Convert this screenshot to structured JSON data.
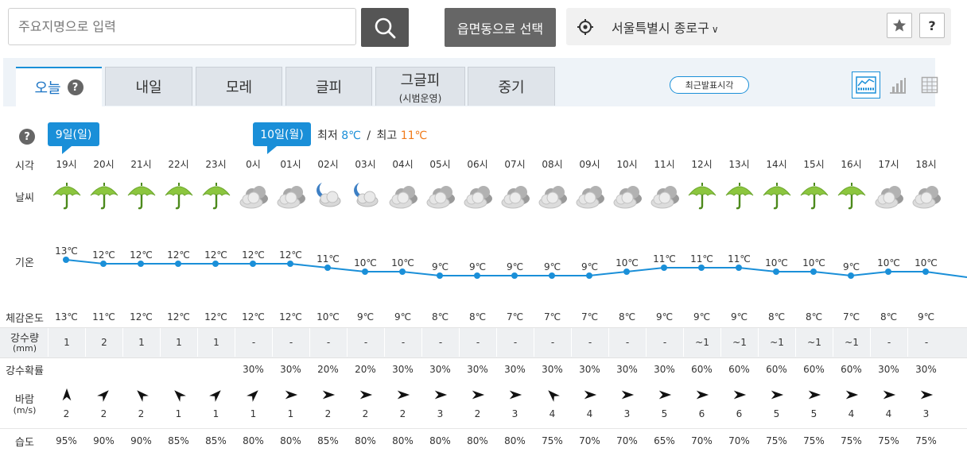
{
  "search": {
    "placeholder": "주요지명으로 입력"
  },
  "region_button": "읍면동으로 선택",
  "location": {
    "name": "서울특별시 종로구",
    "chevron": "∨"
  },
  "help_mark": "?",
  "tabs": [
    {
      "label": "오늘",
      "active": true,
      "has_help": true,
      "sub": ""
    },
    {
      "label": "내일",
      "active": false,
      "has_help": false,
      "sub": ""
    },
    {
      "label": "모레",
      "active": false,
      "has_help": false,
      "sub": ""
    },
    {
      "label": "글피",
      "active": false,
      "has_help": false,
      "sub": ""
    },
    {
      "label": "그글피",
      "active": false,
      "has_help": false,
      "sub": "(시범운영)"
    },
    {
      "label": "중기",
      "active": false,
      "has_help": false,
      "sub": ""
    }
  ],
  "recent_time_button": "최근발표시각",
  "view_toggles": [
    "graph-view-icon",
    "bar-chart-icon",
    "table-view-icon"
  ],
  "day_tags": [
    "9일(일)",
    "10일(월)"
  ],
  "minmax": {
    "min_label": "최저",
    "min_value": "8℃",
    "sep": "/",
    "max_label": "최고",
    "max_value": "11℃",
    "min_color": "#1a8fd8",
    "max_color": "#f07a1a"
  },
  "row_labels": {
    "time": "시각",
    "weather": "날씨",
    "temp": "기온",
    "feels": "체감온도",
    "precip": "강수량",
    "precip_unit": "(mm)",
    "prob": "강수확률",
    "wind": "바람",
    "wind_unit": "(m/s)",
    "humidity": "습도"
  },
  "hours": [
    {
      "time": "19시",
      "icon": "umbrella",
      "temp": "13℃",
      "t": 13,
      "feels": "13℃",
      "precip": "1",
      "prob": "",
      "dir": 0,
      "wind": "2",
      "hum": "95%"
    },
    {
      "time": "20시",
      "icon": "umbrella",
      "temp": "12℃",
      "t": 12,
      "feels": "11℃",
      "precip": "2",
      "prob": "",
      "dir": 45,
      "wind": "2",
      "hum": "90%"
    },
    {
      "time": "21시",
      "icon": "umbrella",
      "temp": "12℃",
      "t": 12,
      "feels": "12℃",
      "precip": "1",
      "prob": "",
      "dir": 315,
      "wind": "2",
      "hum": "90%"
    },
    {
      "time": "22시",
      "icon": "umbrella",
      "temp": "12℃",
      "t": 12,
      "feels": "12℃",
      "precip": "1",
      "prob": "",
      "dir": 315,
      "wind": "1",
      "hum": "85%"
    },
    {
      "time": "23시",
      "icon": "umbrella",
      "temp": "12℃",
      "t": 12,
      "feels": "12℃",
      "precip": "1",
      "prob": "",
      "dir": 45,
      "wind": "1",
      "hum": "85%"
    },
    {
      "time": "0시",
      "icon": "cloudy",
      "temp": "12℃",
      "t": 12,
      "feels": "12℃",
      "precip": "-",
      "prob": "30%",
      "dir": 45,
      "wind": "1",
      "hum": "80%"
    },
    {
      "time": "01시",
      "icon": "cloudy",
      "temp": "12℃",
      "t": 12,
      "feels": "12℃",
      "precip": "-",
      "prob": "30%",
      "dir": 90,
      "wind": "1",
      "hum": "80%"
    },
    {
      "time": "02시",
      "icon": "moon-cloud",
      "temp": "11℃",
      "t": 11,
      "feels": "10℃",
      "precip": "-",
      "prob": "20%",
      "dir": 90,
      "wind": "2",
      "hum": "85%"
    },
    {
      "time": "03시",
      "icon": "moon-cloud",
      "temp": "10℃",
      "t": 10,
      "feels": "9℃",
      "precip": "-",
      "prob": "20%",
      "dir": 90,
      "wind": "2",
      "hum": "80%"
    },
    {
      "time": "04시",
      "icon": "cloudy",
      "temp": "10℃",
      "t": 10,
      "feels": "9℃",
      "precip": "-",
      "prob": "30%",
      "dir": 90,
      "wind": "2",
      "hum": "80%"
    },
    {
      "time": "05시",
      "icon": "cloudy",
      "temp": "9℃",
      "t": 9,
      "feels": "8℃",
      "precip": "-",
      "prob": "30%",
      "dir": 90,
      "wind": "3",
      "hum": "80%"
    },
    {
      "time": "06시",
      "icon": "cloudy",
      "temp": "9℃",
      "t": 9,
      "feels": "8℃",
      "precip": "-",
      "prob": "30%",
      "dir": 90,
      "wind": "2",
      "hum": "80%"
    },
    {
      "time": "07시",
      "icon": "cloudy",
      "temp": "9℃",
      "t": 9,
      "feels": "7℃",
      "precip": "-",
      "prob": "30%",
      "dir": 90,
      "wind": "3",
      "hum": "80%"
    },
    {
      "time": "08시",
      "icon": "cloudy",
      "temp": "9℃",
      "t": 9,
      "feels": "7℃",
      "precip": "-",
      "prob": "30%",
      "dir": 315,
      "wind": "4",
      "hum": "75%"
    },
    {
      "time": "09시",
      "icon": "cloudy",
      "temp": "9℃",
      "t": 9,
      "feels": "7℃",
      "precip": "-",
      "prob": "30%",
      "dir": 90,
      "wind": "4",
      "hum": "70%"
    },
    {
      "time": "10시",
      "icon": "cloudy",
      "temp": "10℃",
      "t": 10,
      "feels": "8℃",
      "precip": "-",
      "prob": "30%",
      "dir": 90,
      "wind": "3",
      "hum": "70%"
    },
    {
      "time": "11시",
      "icon": "cloudy",
      "temp": "11℃",
      "t": 11,
      "feels": "9℃",
      "precip": "-",
      "prob": "30%",
      "dir": 90,
      "wind": "5",
      "hum": "65%"
    },
    {
      "time": "12시",
      "icon": "umbrella",
      "temp": "11℃",
      "t": 11,
      "feels": "9℃",
      "precip": "~1",
      "prob": "60%",
      "dir": 90,
      "wind": "6",
      "hum": "70%"
    },
    {
      "time": "13시",
      "icon": "umbrella",
      "temp": "11℃",
      "t": 11,
      "feels": "9℃",
      "precip": "~1",
      "prob": "60%",
      "dir": 90,
      "wind": "6",
      "hum": "70%"
    },
    {
      "time": "14시",
      "icon": "umbrella",
      "temp": "10℃",
      "t": 10,
      "feels": "8℃",
      "precip": "~1",
      "prob": "60%",
      "dir": 90,
      "wind": "5",
      "hum": "75%"
    },
    {
      "time": "15시",
      "icon": "umbrella",
      "temp": "10℃",
      "t": 10,
      "feels": "8℃",
      "precip": "~1",
      "prob": "60%",
      "dir": 90,
      "wind": "5",
      "hum": "75%"
    },
    {
      "time": "16시",
      "icon": "umbrella",
      "temp": "9℃",
      "t": 9,
      "feels": "7℃",
      "precip": "~1",
      "prob": "60%",
      "dir": 90,
      "wind": "4",
      "hum": "75%"
    },
    {
      "time": "17시",
      "icon": "cloudy",
      "temp": "10℃",
      "t": 10,
      "feels": "8℃",
      "precip": "-",
      "prob": "30%",
      "dir": 90,
      "wind": "4",
      "hum": "75%"
    },
    {
      "time": "18시",
      "icon": "cloudy",
      "temp": "10℃",
      "t": 10,
      "feels": "9℃",
      "precip": "-",
      "prob": "30%",
      "dir": 90,
      "wind": "3",
      "hum": "75%"
    }
  ],
  "temp_line_color": "#1a8fd8"
}
